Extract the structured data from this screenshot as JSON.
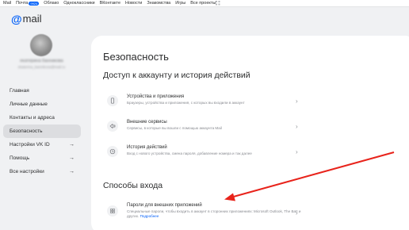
{
  "topbar": {
    "items": [
      "Mail",
      "Почта",
      "Облако",
      "Одноклассники",
      "ВКонтакте",
      "Новости",
      "Знакомства",
      "Игры",
      "Все проекты"
    ],
    "mail_badge": "9924"
  },
  "logo": {
    "at": "@",
    "word": "mail"
  },
  "user": {
    "name": "екатерина банникова",
    "email": "ekaterina_bannikova@mail.ru"
  },
  "sidebar": {
    "items": [
      {
        "label": "Главная",
        "arrow": ""
      },
      {
        "label": "Личные данные",
        "arrow": ""
      },
      {
        "label": "Контакты и адреса",
        "arrow": ""
      },
      {
        "label": "Безопасность",
        "arrow": "",
        "active": true
      },
      {
        "label": "Настройки VK ID",
        "arrow": "→"
      },
      {
        "label": "Помощь",
        "arrow": "→"
      },
      {
        "label": "Все настройки",
        "arrow": "→"
      }
    ]
  },
  "main": {
    "title": "Безопасность",
    "section1_title": "Доступ к аккаунту и история действий",
    "section2_title": "Способы входа",
    "rows": [
      {
        "title": "Устройства и приложения",
        "desc": "Браузеры, устройства и приложения, с которых вы входили в аккаунт",
        "icon": "phone-icon"
      },
      {
        "title": "Внешние сервисы",
        "desc": "Сервисы, в которые вы вошли с помощью аккаунта Mail",
        "icon": "external-service-icon"
      },
      {
        "title": "История действий",
        "desc": "Вход с нового устройства, смена пароля, добавление номера и так далее",
        "icon": "history-icon"
      },
      {
        "title": "Пароли для внешних приложений",
        "desc": "Специальные пароли, чтобы входить в аккаунт в сторонних приложениях: Microsoft Outlook, The Bat! и других.",
        "more": "Подробнее",
        "icon": "grid-icon"
      }
    ],
    "chevron": "›"
  },
  "colors": {
    "accent": "#005ff9",
    "annotation_arrow": "#e8231b"
  }
}
